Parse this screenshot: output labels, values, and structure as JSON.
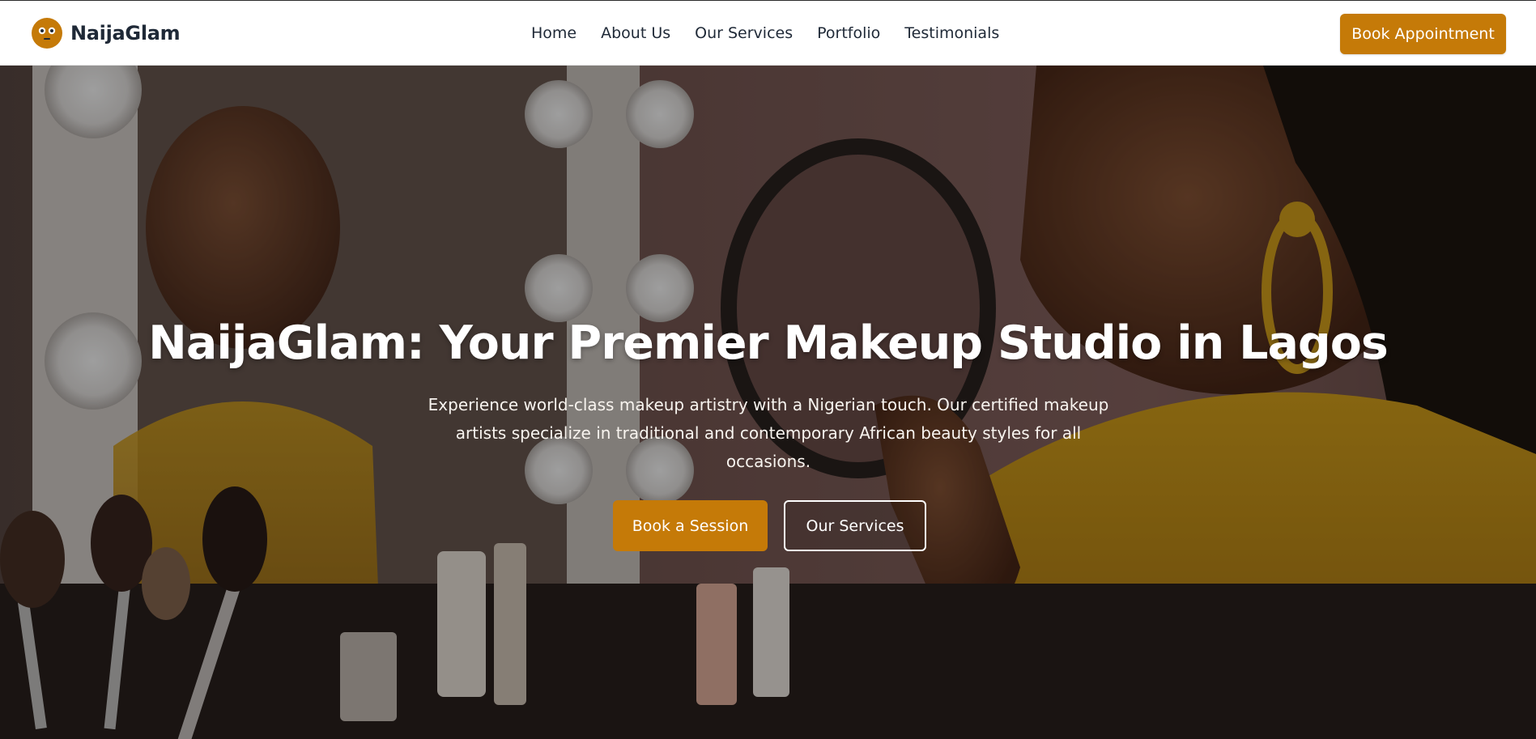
{
  "brand": {
    "name": "NaijaGlam",
    "logo_icon": "mask-face-icon",
    "accent": "#c57a08"
  },
  "nav": {
    "items": [
      {
        "label": "Home"
      },
      {
        "label": "About Us"
      },
      {
        "label": "Our Services"
      },
      {
        "label": "Portfolio"
      },
      {
        "label": "Testimonials"
      }
    ],
    "cta_label": "Book Appointment"
  },
  "hero": {
    "title": "NaijaGlam: Your Premier Makeup Studio in Lagos",
    "subtitle": "Experience world-class makeup artistry with a Nigerian touch. Our certified makeup artists specialize in traditional and contemporary African beauty styles for all occasions.",
    "primary_button": "Book a Session",
    "secondary_button": "Our Services"
  }
}
